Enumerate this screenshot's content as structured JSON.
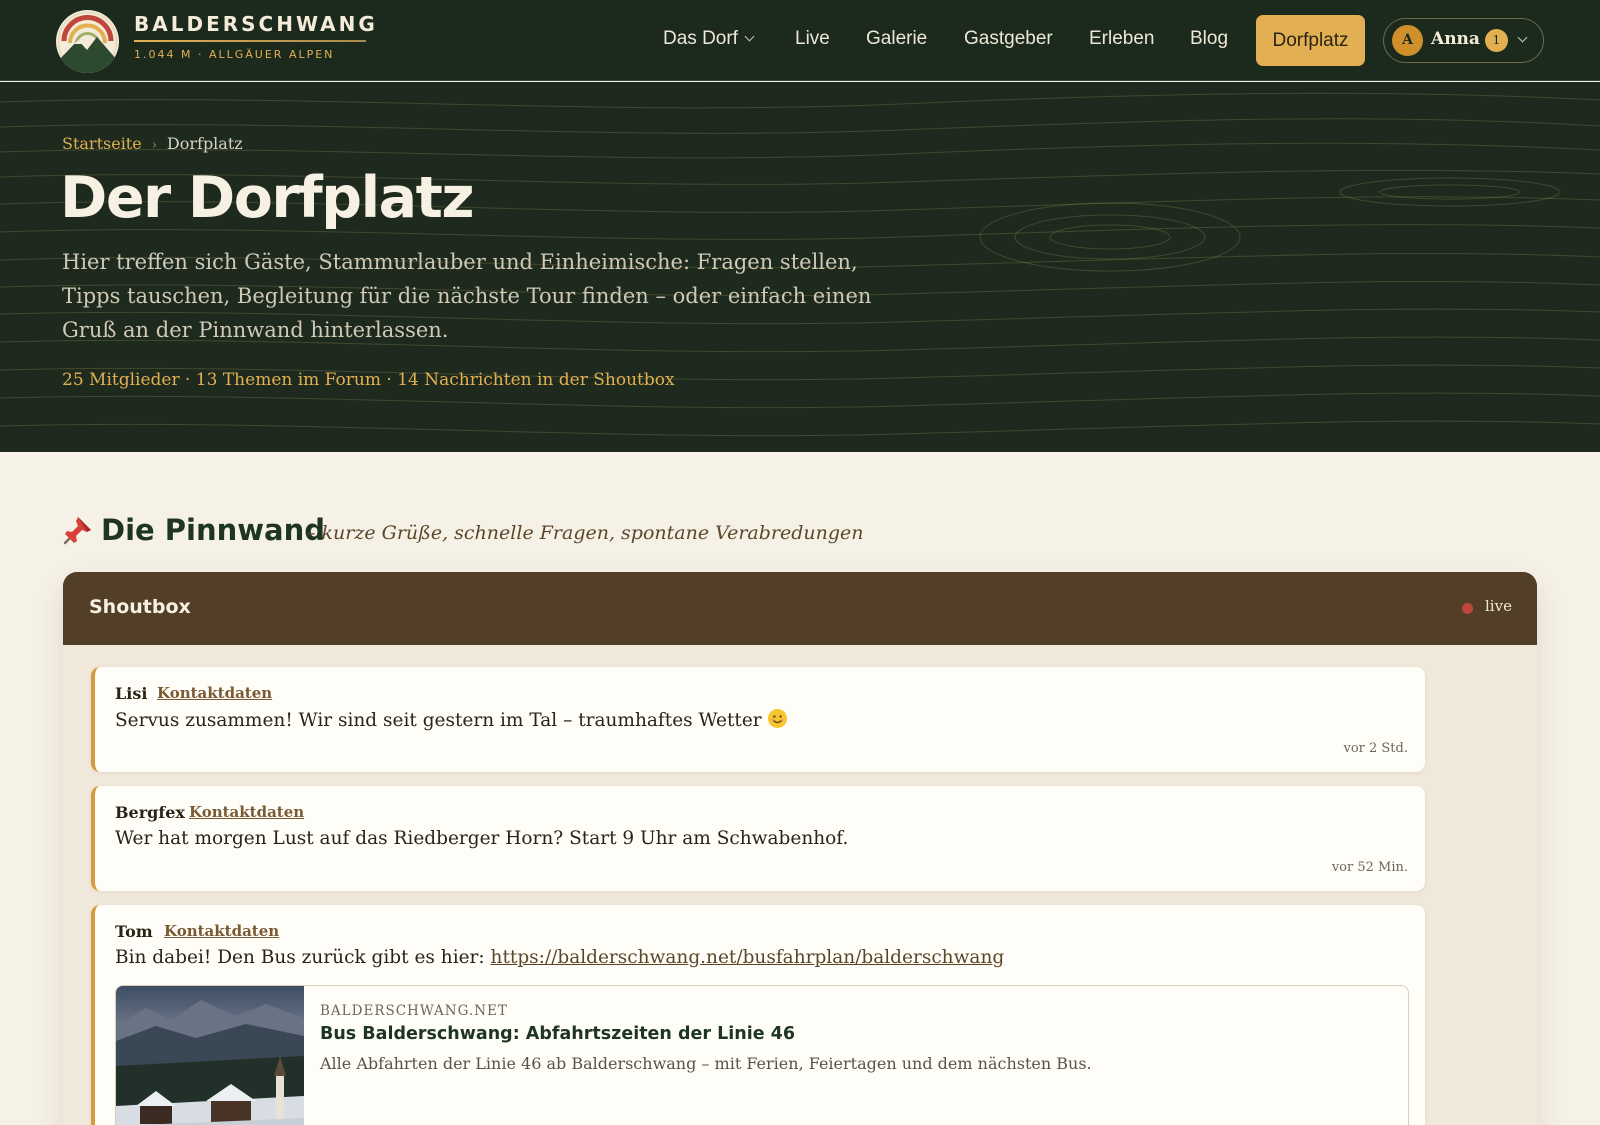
{
  "brand": {
    "name": "BALDERSCHWANG",
    "tagline": "1.044 M · ALLGÄUER ALPEN",
    "colors": {
      "forest": "#1b2a1c",
      "gold": "#e2b053",
      "brown": "#533e27",
      "cream": "#f6f1e7"
    }
  },
  "nav": {
    "items": [
      {
        "label": "Das Dorf",
        "has_dropdown": true
      },
      {
        "label": "Live"
      },
      {
        "label": "Galerie"
      },
      {
        "label": "Gastgeber"
      },
      {
        "label": "Erleben"
      },
      {
        "label": "Blog"
      }
    ],
    "cta": "Dorfplatz",
    "user": {
      "initial": "A",
      "name": "Anna",
      "notifications": "1",
      "icon": "chevron-down-icon"
    }
  },
  "hero": {
    "breadcrumb": {
      "home": "Startseite",
      "separator": "›",
      "current": "Dorfplatz"
    },
    "title": "Der Dorfplatz",
    "intro": "Hier treffen sich Gäste, Stammurlauber und Einheimische: Fragen stellen, Tipps tauschen, Begleitung für die nächste Tour finden – oder einfach einen Gruß an der Pinnwand hinterlassen.",
    "stats": "25 Mitglieder · 13 Themen im Forum · 14 Nachrichten in der Shoutbox"
  },
  "pinnwand": {
    "icon": "pushpin-icon",
    "title": "Die Pinnwand",
    "subtitle": "– kurze Grüße, schnelle Fragen, spontane Verabredungen"
  },
  "shoutbox": {
    "title": "Shoutbox",
    "status": "live",
    "messages": [
      {
        "author": "Lisi",
        "contact": "Kontaktdaten",
        "text": "Servus zusammen! Wir sind seit gestern im Tal – traumhaftes Wetter",
        "emoji": "smiling-face-icon",
        "time": "vor 2 Std."
      },
      {
        "author": "Bergfex",
        "contact": "Kontaktdaten",
        "text": "Wer hat morgen Lust auf das Riedberger Horn? Start 9 Uhr am Schwabenhof.",
        "time": "vor 52 Min."
      },
      {
        "author": "Tom",
        "contact": "Kontaktdaten",
        "text": "Bin dabei! Den Bus zurück gibt es hier:",
        "link": "https://balderschwang.net/busfahrplan/balderschwang",
        "preview": {
          "domain": "BALDERSCHWANG.NET",
          "title": "Bus Balderschwang: Abfahrtszeiten der Linie 46",
          "description": "Alle Abfahrten der Linie 46 ab Balderschwang – mit Ferien, Feiertagen und dem nächsten Bus."
        }
      }
    ]
  }
}
